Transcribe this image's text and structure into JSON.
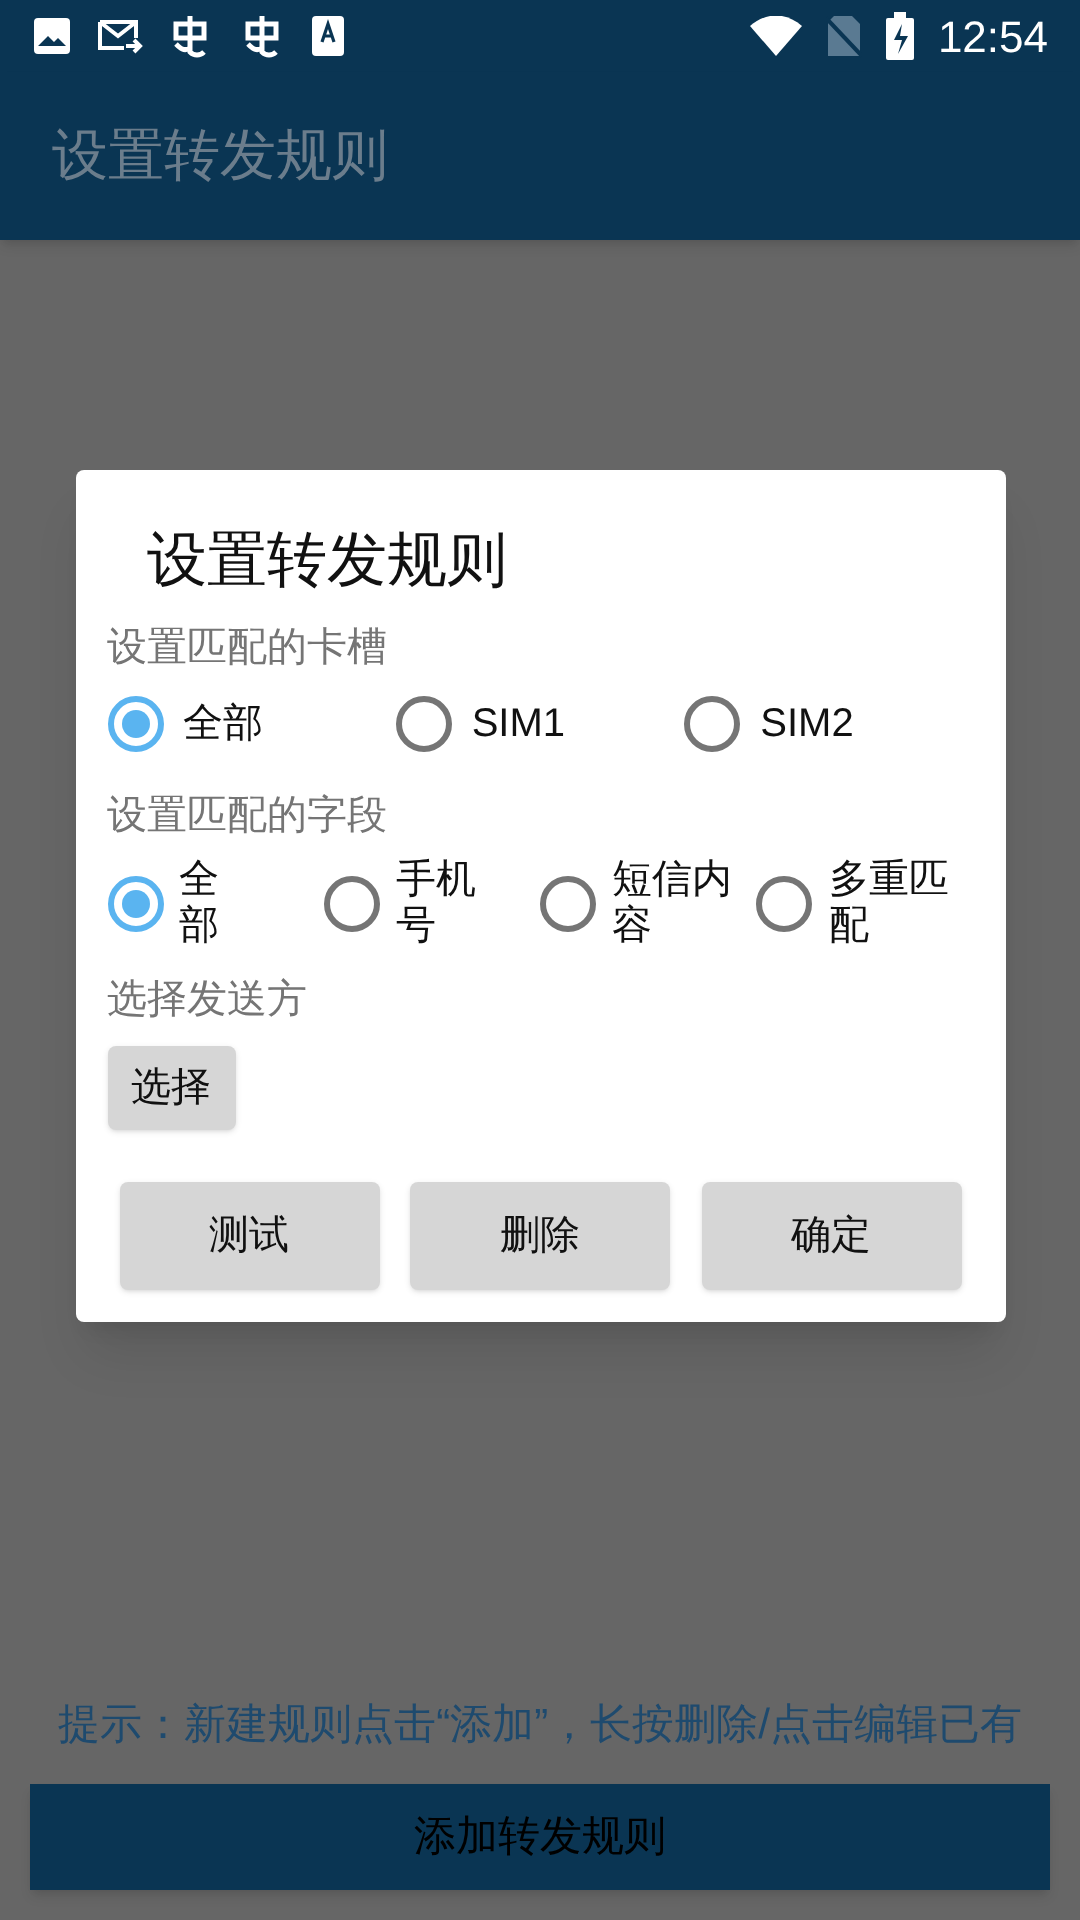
{
  "status_bar": {
    "time": "12:54"
  },
  "app_bar": {
    "title": "设置转发规则"
  },
  "dialog": {
    "title": "设置转发规则",
    "sim_label": "设置匹配的卡槽",
    "sim_options": [
      {
        "label": "全部",
        "selected": true
      },
      {
        "label": "SIM1",
        "selected": false
      },
      {
        "label": "SIM2",
        "selected": false
      }
    ],
    "field_label": "设置匹配的字段",
    "field_options": [
      {
        "label": "全部",
        "selected": true
      },
      {
        "label": "手机号",
        "selected": false
      },
      {
        "label": "短信内容",
        "selected": false
      },
      {
        "label": "多重匹配",
        "selected": false
      }
    ],
    "sender_label": "选择发送方",
    "choose_button": "选择",
    "buttons": [
      "测试",
      "删除",
      "确定"
    ]
  },
  "hint": "提示：新建规则点击“添加”，长按删除/点击编辑已有",
  "add_button": "添加转发规则"
}
